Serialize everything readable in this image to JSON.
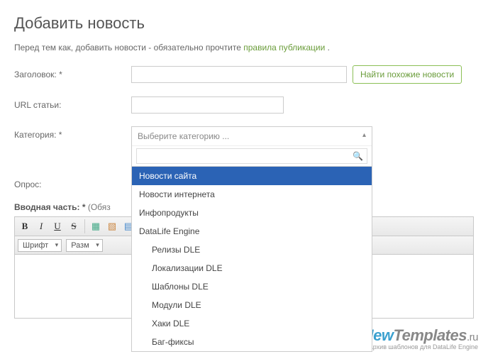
{
  "page": {
    "title": "Добавить новость",
    "intro_before": "Перед тем как, добавить новости - обязательно прочтите ",
    "intro_link": "правила публикации",
    "intro_after": " ."
  },
  "fields": {
    "title_label": "Заголовок: *",
    "url_label": "URL статьи:",
    "category_label": "Категория: *",
    "poll_label": "Опрос:",
    "intro_label": "Вводная часть: *",
    "intro_hint": " (Обяз"
  },
  "buttons": {
    "find_similar": "Найти похожие новости"
  },
  "category": {
    "placeholder": "Выберите категорию ...",
    "search_value": "",
    "items": [
      {
        "label": "Новости сайта",
        "selected": true,
        "indent": false
      },
      {
        "label": "Новости интернета",
        "selected": false,
        "indent": false
      },
      {
        "label": "Инфопродукты",
        "selected": false,
        "indent": false
      },
      {
        "label": "DataLife Engine",
        "selected": false,
        "indent": false
      },
      {
        "label": "Релизы DLE",
        "selected": false,
        "indent": true
      },
      {
        "label": "Локализации DLE",
        "selected": false,
        "indent": true
      },
      {
        "label": "Шаблоны DLE",
        "selected": false,
        "indent": true
      },
      {
        "label": "Модули DLE",
        "selected": false,
        "indent": true
      },
      {
        "label": "Хаки DLE",
        "selected": false,
        "indent": true
      },
      {
        "label": "Баг-фиксы",
        "selected": false,
        "indent": true
      }
    ]
  },
  "editor": {
    "font_label": "Шрифт",
    "size_label": "Разм"
  },
  "watermark": {
    "brand_n": "New",
    "brand_t": "Templates",
    "brand_ru": ".ru",
    "sub": "Архив шаблонов для DataLife Engine"
  }
}
